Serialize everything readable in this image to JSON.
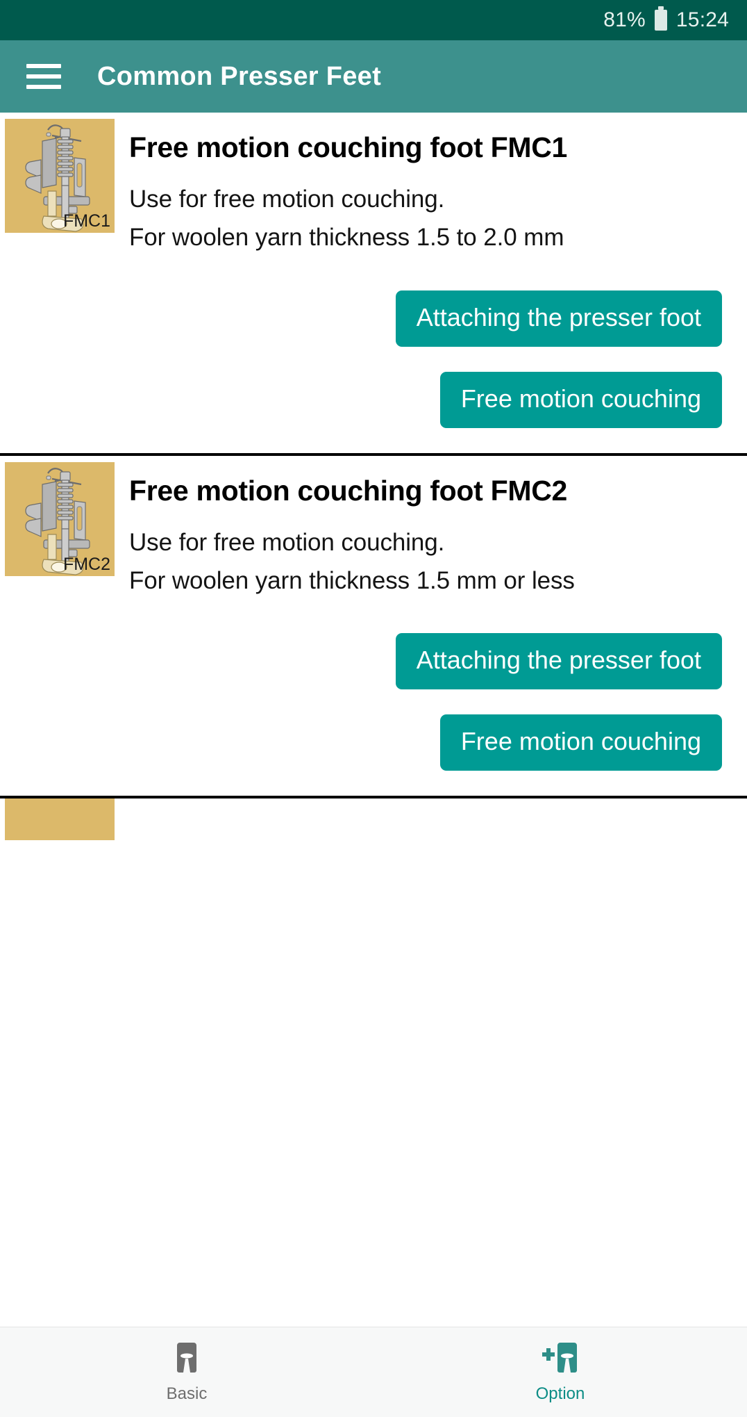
{
  "status_bar": {
    "battery_percent": "81%",
    "battery_icon": "battery-icon",
    "time": "15:24",
    "background_color": "#005a4d"
  },
  "app_bar": {
    "menu_icon": "hamburger-menu-icon",
    "title": "Common  Presser Feet",
    "background_color": "#3d918d",
    "text_color": "#ffffff"
  },
  "theme": {
    "button_color": "#009b94",
    "thumbnail_background": "#dcb96a",
    "active_nav_color": "#0d8d86",
    "inactive_nav_color": "#6e6e6e",
    "divider_color": "#000000"
  },
  "cards": [
    {
      "thumbnail_label": "FMC1",
      "thumbnail_icon": "presser-foot-illustration",
      "title": "Free motion couching foot FMC1",
      "description_line_1": "Use for free motion couching.",
      "description_line_2": "For woolen yarn thickness 1.5 to 2.0 mm",
      "buttons": [
        {
          "label": "Attaching the presser foot"
        },
        {
          "label": "Free motion couching"
        }
      ]
    },
    {
      "thumbnail_label": "FMC2",
      "thumbnail_icon": "presser-foot-illustration",
      "title": "Free motion couching foot FMC2",
      "description_line_1": "Use for free motion couching.",
      "description_line_2": "For woolen yarn thickness 1.5 mm or less",
      "buttons": [
        {
          "label": "Attaching the presser foot"
        },
        {
          "label": "Free motion couching"
        }
      ]
    }
  ],
  "bottom_nav": {
    "items": [
      {
        "label": "Basic",
        "icon": "presser-foot-icon",
        "active": false
      },
      {
        "label": "Option",
        "icon": "presser-foot-plus-icon",
        "active": true
      }
    ]
  }
}
